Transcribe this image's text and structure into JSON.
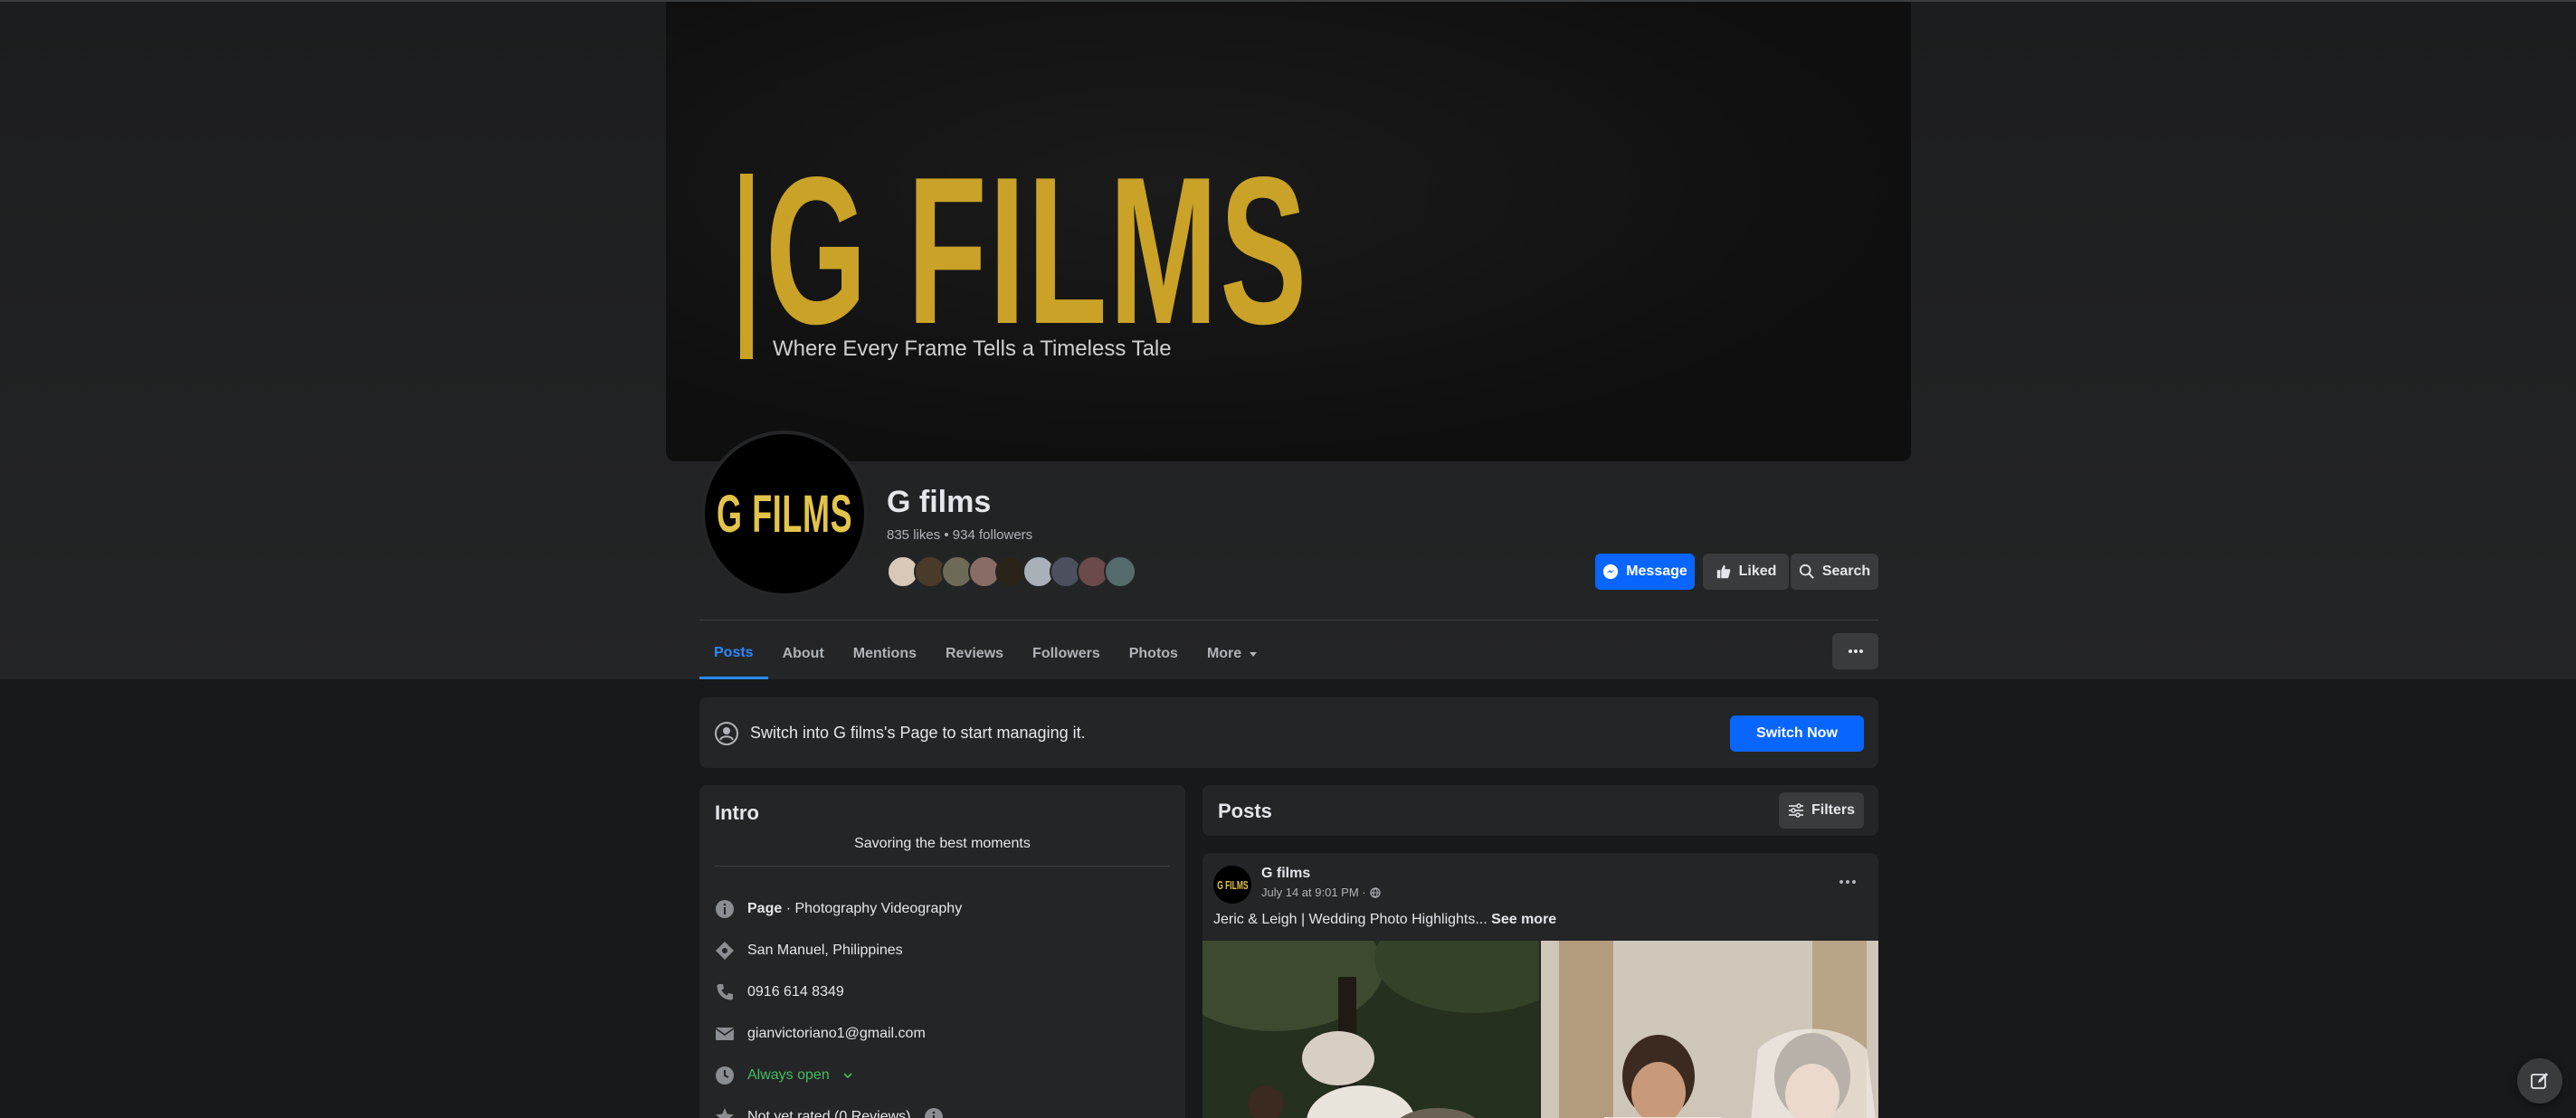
{
  "cover": {
    "title": "G FILMS",
    "tagline": "Where Every Frame Tells a Timeless Tale"
  },
  "profile": {
    "avatar_text": "G FILMS",
    "name": "G films",
    "stats": "835 likes • 934 followers",
    "follower_avatar_colors": [
      "#d9c8b8",
      "#4a3a2a",
      "#6e6a58",
      "#8a6c66",
      "#2a2418",
      "#aab0b8",
      "#4b4f5e",
      "#6a4a4a",
      "#556a6a"
    ]
  },
  "actions": {
    "message_label": "Message",
    "liked_label": "Liked",
    "search_label": "Search"
  },
  "tabs": [
    {
      "label": "Posts",
      "active": true
    },
    {
      "label": "About",
      "active": false
    },
    {
      "label": "Mentions",
      "active": false
    },
    {
      "label": "Reviews",
      "active": false
    },
    {
      "label": "Followers",
      "active": false
    },
    {
      "label": "Photos",
      "active": false
    },
    {
      "label": "More",
      "active": false
    }
  ],
  "switch_bar": {
    "text": "Switch into G films's Page to start managing it.",
    "button_label": "Switch Now"
  },
  "intro": {
    "title": "Intro",
    "bio": "Savoring the best moments",
    "category_bold": "Page",
    "category_rest": " · Photography Videography",
    "location": "San Manuel, Philippines",
    "phone": "0916 614 8349",
    "email": "gianvictoriano1@gmail.com",
    "hours": "Always open",
    "rating": "Not yet rated (0 Reviews)"
  },
  "posts_section": {
    "title": "Posts",
    "filters_label": "Filters"
  },
  "post": {
    "avatar_text": "G FILMS",
    "author": "G films",
    "timestamp": "July 14 at 9:01 PM ·",
    "text": "Jeric & Leigh | Wedding Photo Highlights...",
    "see_more": "See more"
  },
  "colors": {
    "accent": "#0866ff",
    "brand_gold": "#c9a227",
    "tab_active": "#2d88ff",
    "open_green": "#45bd62"
  },
  "icons": [
    "messenger-icon",
    "thumbs-up-icon",
    "search-icon",
    "caret-down-icon",
    "ellipsis-icon",
    "profile-switch-icon",
    "info-icon",
    "tag-icon",
    "phone-icon",
    "mail-icon",
    "clock-icon",
    "chevron-down-icon",
    "star-icon",
    "filters-icon",
    "globe-icon",
    "edit-icon"
  ]
}
